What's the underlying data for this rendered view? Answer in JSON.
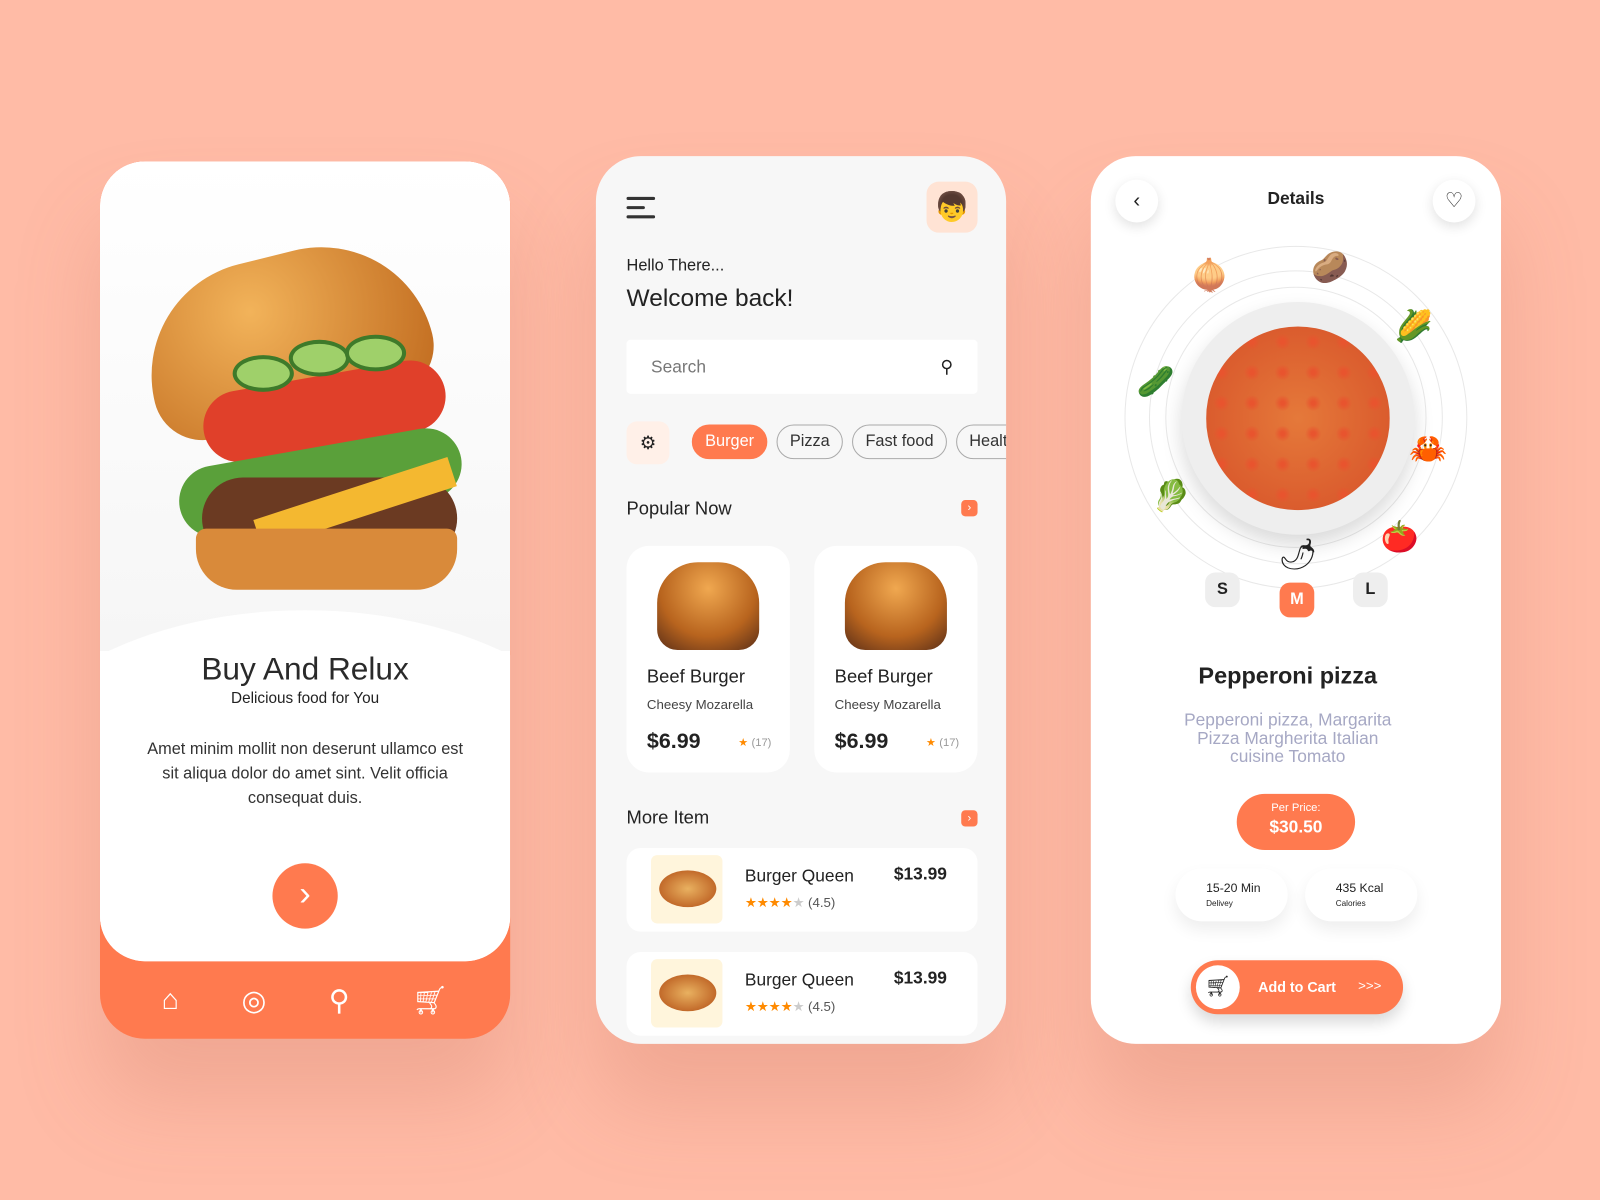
{
  "colors": {
    "accent": "#FF7A4F",
    "background": "#FFBBA6"
  },
  "onboarding": {
    "title": "Buy And Relux",
    "subtitle": "Delicious food for You",
    "description": "Amet minim mollit non deserunt ullamco est sit aliqua dolor do amet sint. Velit officia consequat duis.",
    "next_icon": "chevron-right-icon",
    "nav": [
      "home-icon",
      "profile-icon",
      "search-icon",
      "cart-icon"
    ]
  },
  "home": {
    "greeting": "Hello There...",
    "welcome": "Welcome back!",
    "search_placeholder": "Search",
    "categories": [
      {
        "label": "Burger",
        "active": true
      },
      {
        "label": "Pizza"
      },
      {
        "label": "Fast food"
      },
      {
        "label": "Health"
      }
    ],
    "popular_title": "Popular Now",
    "popular": [
      {
        "name": "Beef Burger",
        "sub": "Cheesy Mozarella",
        "price": "$6.99",
        "reviews": "(17)"
      },
      {
        "name": "Beef Burger",
        "sub": "Cheesy Mozarella",
        "price": "$6.99",
        "reviews": "(17)"
      }
    ],
    "more_title": "More Item",
    "more": [
      {
        "name": "Burger Queen",
        "price": "$13.99",
        "rating": "(4.5)",
        "stars": 4
      },
      {
        "name": "Burger Queen",
        "price": "$13.99",
        "rating": "(4.5)",
        "stars": 4
      }
    ]
  },
  "details": {
    "title": "Details",
    "sizes": [
      {
        "label": "S"
      },
      {
        "label": "M",
        "active": true
      },
      {
        "label": "L"
      }
    ],
    "name": "Pepperoni pizza",
    "description": "Pepperoni pizza, Margarita Pizza Margherita Italian cuisine Tomato",
    "price_label": "Per Price:",
    "price": "$30.50",
    "delivery_value": "15-20 Min",
    "delivery_label": "Delivey",
    "calories_value": "435 Kcal",
    "calories_label": "Calories",
    "cart_label": "Add to Cart",
    "cart_chevrons": ">>>"
  }
}
